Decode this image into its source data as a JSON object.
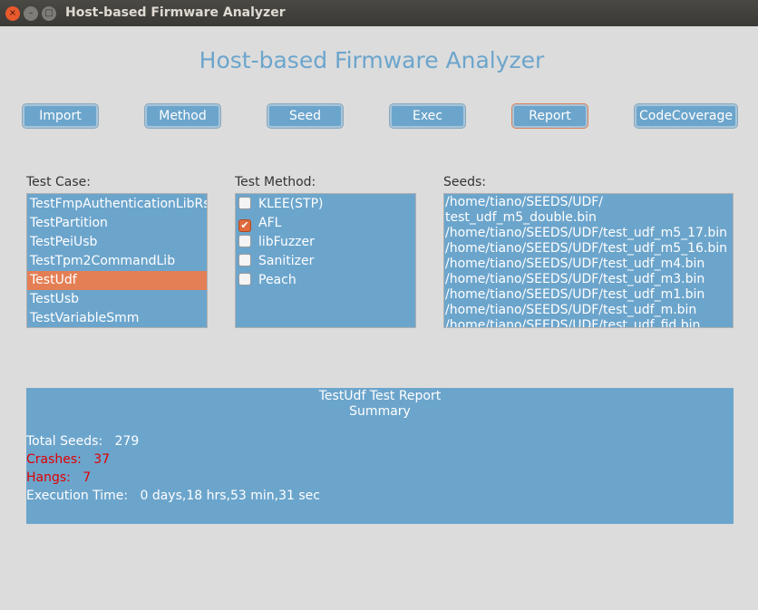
{
  "window": {
    "title": "Host-based Firmware Analyzer"
  },
  "app_title": "Host-based Firmware Analyzer",
  "toolbar": [
    {
      "label": "Import"
    },
    {
      "label": "Method"
    },
    {
      "label": "Seed"
    },
    {
      "label": "Exec"
    },
    {
      "label": "Report"
    },
    {
      "label": "CodeCoverage"
    }
  ],
  "test_case": {
    "label": "Test Case:",
    "items": [
      "TestFmpAuthenticationLibRsa",
      "TestPartition",
      "TestPeiUsb",
      "TestTpm2CommandLib",
      "TestUdf",
      "TestUsb",
      "TestVariableSmm"
    ],
    "selected": "TestUdf"
  },
  "test_method": {
    "label": "Test Method:",
    "items": [
      {
        "label": "KLEE(STP)",
        "checked": false
      },
      {
        "label": "AFL",
        "checked": true
      },
      {
        "label": "libFuzzer",
        "checked": false
      },
      {
        "label": "Sanitizer",
        "checked": false
      },
      {
        "label": "Peach",
        "checked": false
      }
    ]
  },
  "seeds": {
    "label": "Seeds:",
    "items": [
      "/home/tiano/SEEDS/UDF/",
      "test_udf_m5_double.bin",
      "/home/tiano/SEEDS/UDF/test_udf_m5_17.bin",
      "/home/tiano/SEEDS/UDF/test_udf_m5_16.bin",
      "/home/tiano/SEEDS/UDF/test_udf_m4.bin",
      "/home/tiano/SEEDS/UDF/test_udf_m3.bin",
      "/home/tiano/SEEDS/UDF/test_udf_m1.bin",
      "/home/tiano/SEEDS/UDF/test_udf_m.bin",
      "/home/tiano/SEEDS/UDF/test_udf_fid.bin"
    ]
  },
  "report": {
    "title": "TestUdf Test Report",
    "subtitle": "Summary",
    "total_seeds": "Total Seeds:   279",
    "crashes": "Crashes:   37",
    "hangs": "Hangs:   7",
    "execution_time": "Execution Time:   0 days,18 hrs,53 min,31 sec"
  },
  "colors": {
    "accent": "#6ca5cc",
    "selection": "#e47f55",
    "alert": "#e00000"
  }
}
